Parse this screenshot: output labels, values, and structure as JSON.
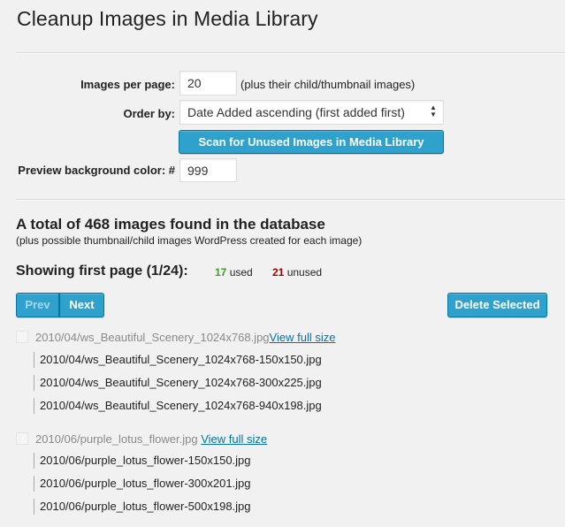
{
  "page": {
    "title": "Cleanup Images in Media Library"
  },
  "form": {
    "images_per_page_label": "Images per page:",
    "images_per_page_value": "20",
    "images_per_page_hint": "(plus their child/thumbnail images)",
    "order_by_label": "Order by:",
    "order_by_selected": "Date Added ascending (first added first)",
    "scan_button_label": "Scan for Unused Images in Media Library",
    "preview_bg_label": "Preview background color: #",
    "preview_bg_value": "999"
  },
  "results": {
    "total_heading": "A total of 468 images found in the database",
    "total_subtext": "(plus possible thumbnail/child images WordPress created for each image)",
    "showing_label": "Showing first page (1/24):",
    "used_count": "17",
    "used_label": "used",
    "unused_count": "21",
    "unused_label": "unused"
  },
  "pagination": {
    "prev_label": "Prev",
    "next_label": "Next",
    "delete_label": "Delete Selected"
  },
  "images": [
    {
      "name": "2010/04/ws_Beautiful_Scenery_1024x768.jpg",
      "view_link": "View full size",
      "children": [
        "2010/04/ws_Beautiful_Scenery_1024x768-150x150.jpg",
        "2010/04/ws_Beautiful_Scenery_1024x768-300x225.jpg",
        "2010/04/ws_Beautiful_Scenery_1024x768-940x198.jpg"
      ]
    },
    {
      "name": "2010/06/purple_lotus_flower.jpg",
      "view_link": "View full size",
      "children": [
        "2010/06/purple_lotus_flower-150x150.jpg",
        "2010/06/purple_lotus_flower-300x201.jpg",
        "2010/06/purple_lotus_flower-500x198.jpg"
      ]
    }
  ],
  "colors": {
    "page_background": "#f1f1f1",
    "primary_button": "#2ea2cc",
    "link": "#0074a2",
    "used_count": "#3a9d23",
    "unused_count": "#aa0000"
  }
}
